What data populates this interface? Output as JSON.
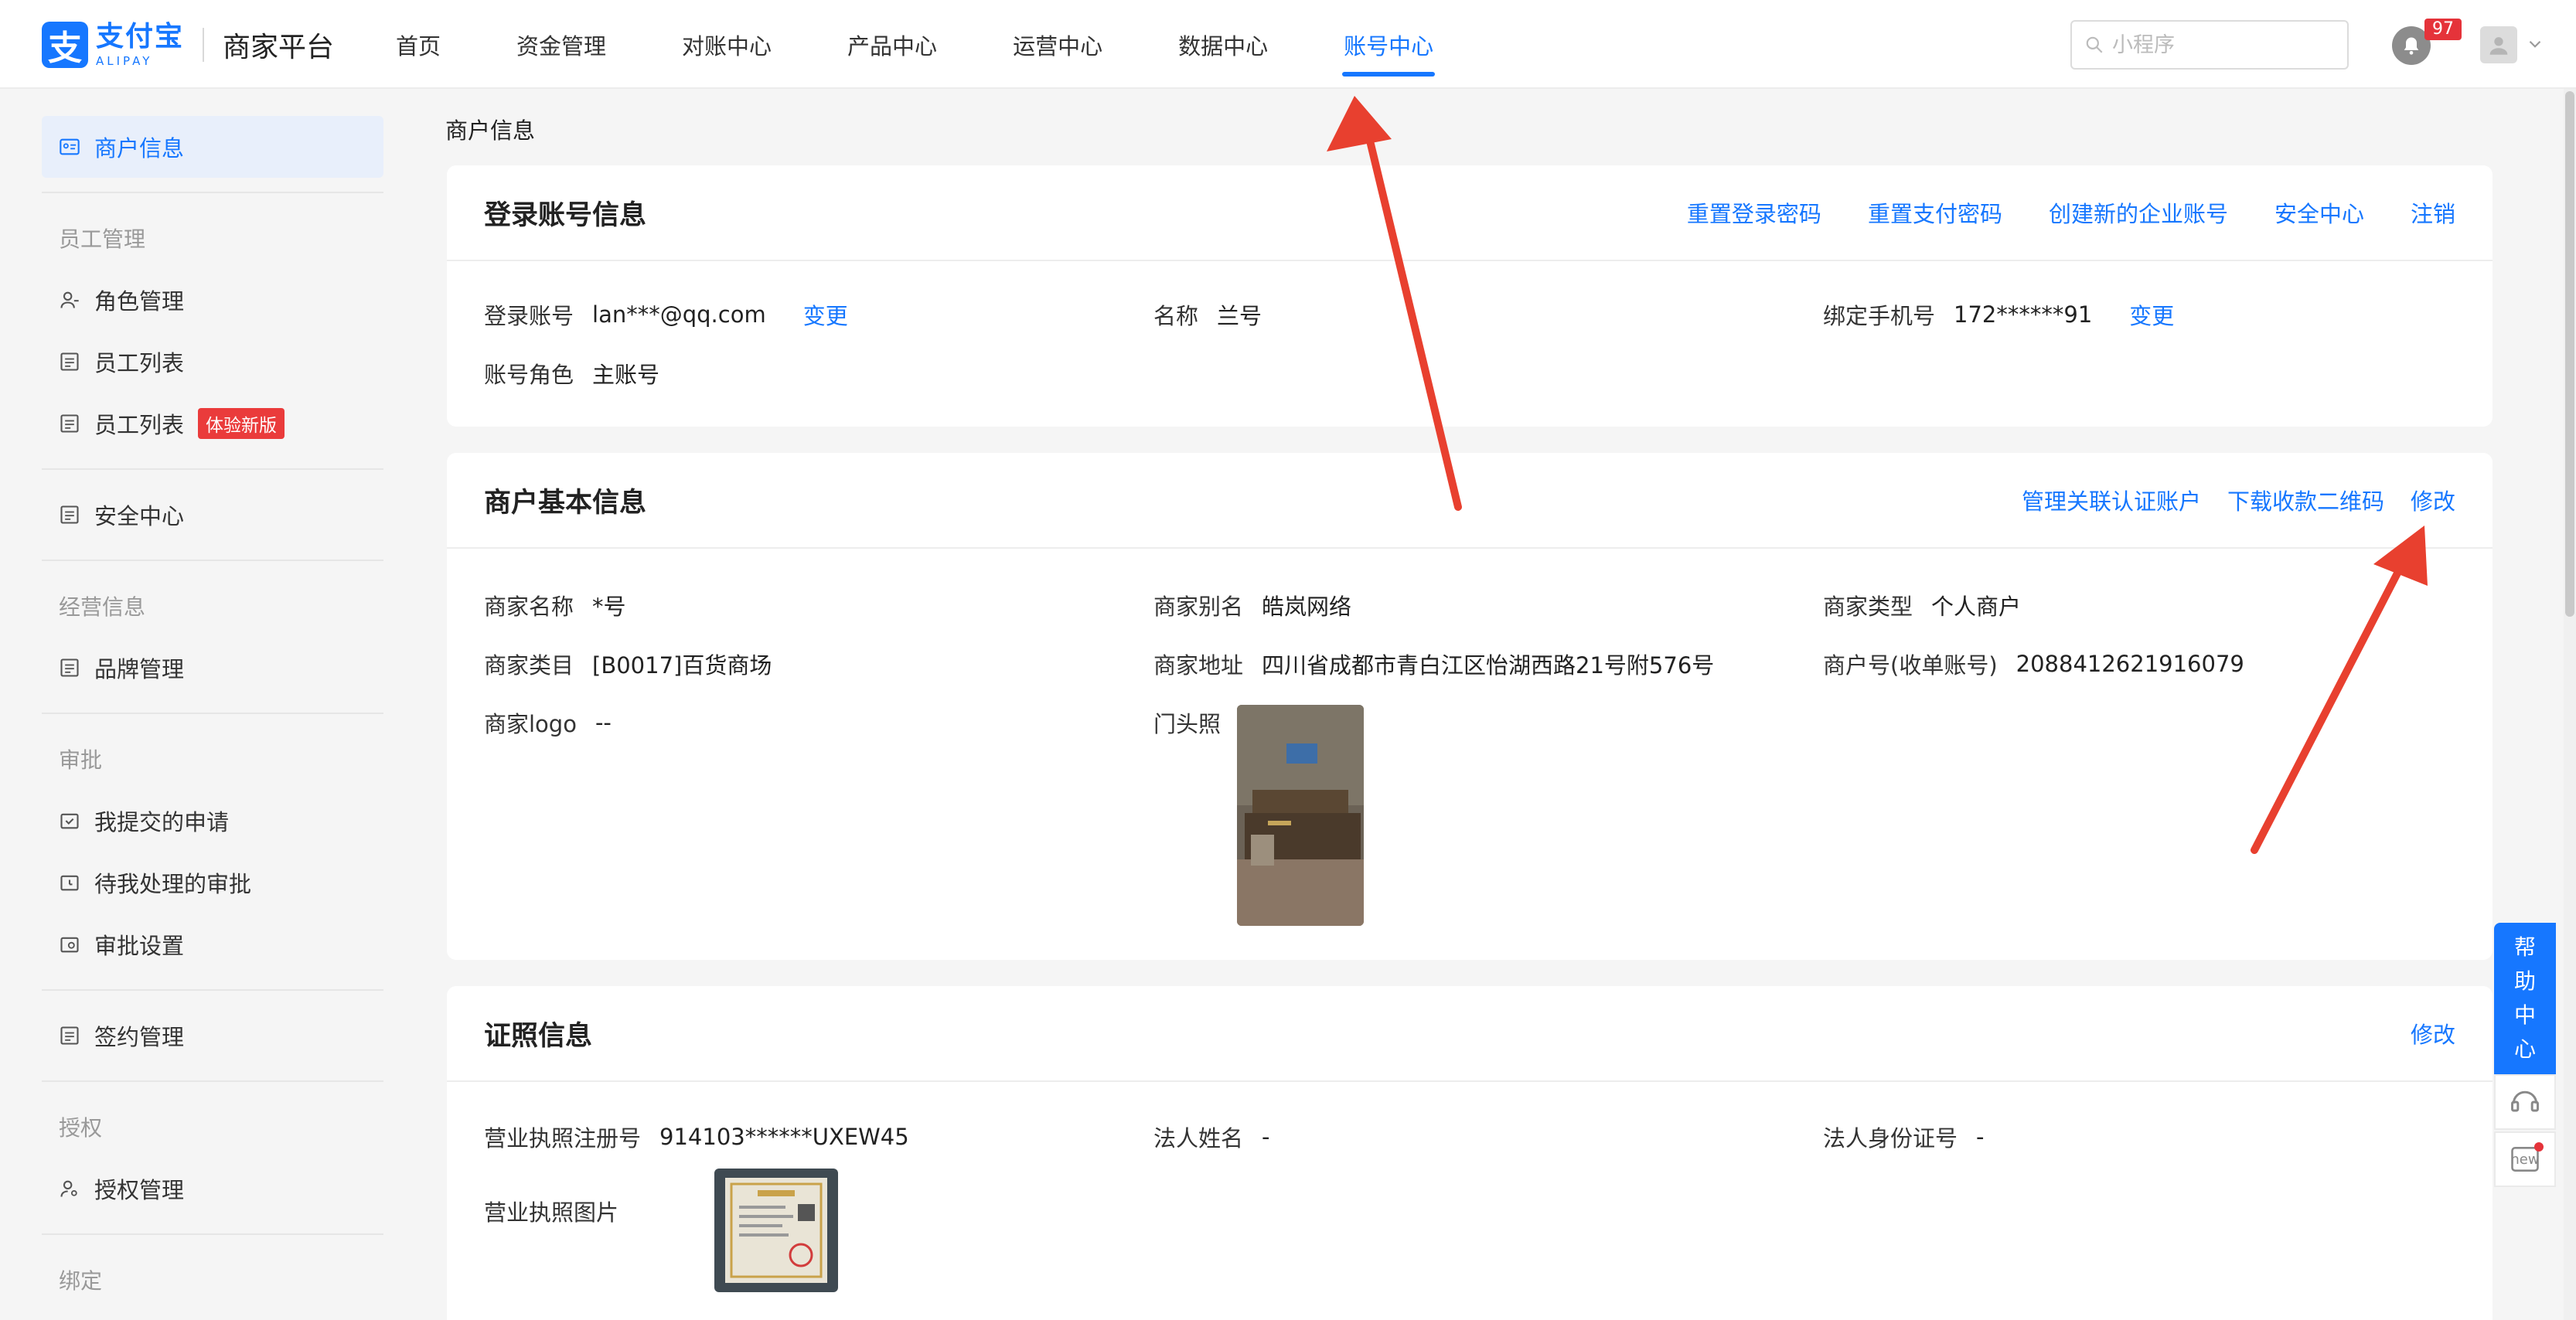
{
  "header": {
    "logo_cn": "支付宝",
    "logo_en": "ALIPAY",
    "platform": "商家平台",
    "nav": [
      {
        "label": "首页"
      },
      {
        "label": "资金管理"
      },
      {
        "label": "对账中心"
      },
      {
        "label": "产品中心"
      },
      {
        "label": "运营中心"
      },
      {
        "label": "数据中心"
      },
      {
        "label": "账号中心"
      }
    ],
    "active_nav": "账号中心",
    "search_placeholder": "小程序",
    "notification_count": "97"
  },
  "sidebar": {
    "items": [
      {
        "label": "商户信息"
      },
      {
        "label": "员工管理"
      },
      {
        "label": "角色管理"
      },
      {
        "label": "员工列表"
      },
      {
        "label": "员工列表"
      },
      {
        "label": "安全中心"
      },
      {
        "label": "经营信息"
      },
      {
        "label": "品牌管理"
      },
      {
        "label": "审批"
      },
      {
        "label": "我提交的申请"
      },
      {
        "label": "待我处理的审批"
      },
      {
        "label": "审批设置"
      },
      {
        "label": "签约管理"
      },
      {
        "label": "授权"
      },
      {
        "label": "授权管理"
      },
      {
        "label": "绑定"
      }
    ],
    "trial_tag": "体验新版"
  },
  "breadcrumb": "商户信息",
  "login_card": {
    "title": "登录账号信息",
    "actions": [
      "重置登录密码",
      "重置支付密码",
      "创建新的企业账号",
      "安全中心",
      "注销"
    ],
    "account_label": "登录账号",
    "account_value": "lan***@qq.com",
    "change_label": "变更",
    "name_label": "名称",
    "name_value": "兰号",
    "phone_label": "绑定手机号",
    "phone_value": "172******91",
    "role_label": "账号角色",
    "role_value": "主账号"
  },
  "basic_card": {
    "title": "商户基本信息",
    "actions": [
      "管理关联认证账户",
      "下载收款二维码",
      "修改"
    ],
    "merchant_name_label": "商家名称",
    "merchant_name_value": "*号",
    "alias_label": "商家别名",
    "alias_value": "皓岚网络",
    "type_label": "商家类型",
    "type_value": "个人商户",
    "category_label": "商家类目",
    "category_value": "[B0017]百货商场",
    "address_label": "商家地址",
    "address_value": "四川省成都市青白江区怡湖西路21号附576号",
    "pid_label": "商户号(收单账号)",
    "pid_value": "2088412621916079",
    "logo_label": "商家logo",
    "logo_value": "--",
    "storefront_label": "门头照"
  },
  "license_card": {
    "title": "证照信息",
    "edit_label": "修改",
    "reg_no_label": "营业执照注册号",
    "reg_no_value": "914103******UXEW45",
    "legal_name_label": "法人姓名",
    "legal_name_value": "-",
    "legal_id_label": "法人身份证号",
    "legal_id_value": "-",
    "license_image_label": "营业执照图片"
  },
  "help": {
    "label_chars": [
      "帮",
      "助",
      "中",
      "心"
    ],
    "new_label": "new"
  },
  "colors": {
    "accent": "#1677ff",
    "annotation_arrow": "#e8402f",
    "badge": "#e5333a"
  }
}
